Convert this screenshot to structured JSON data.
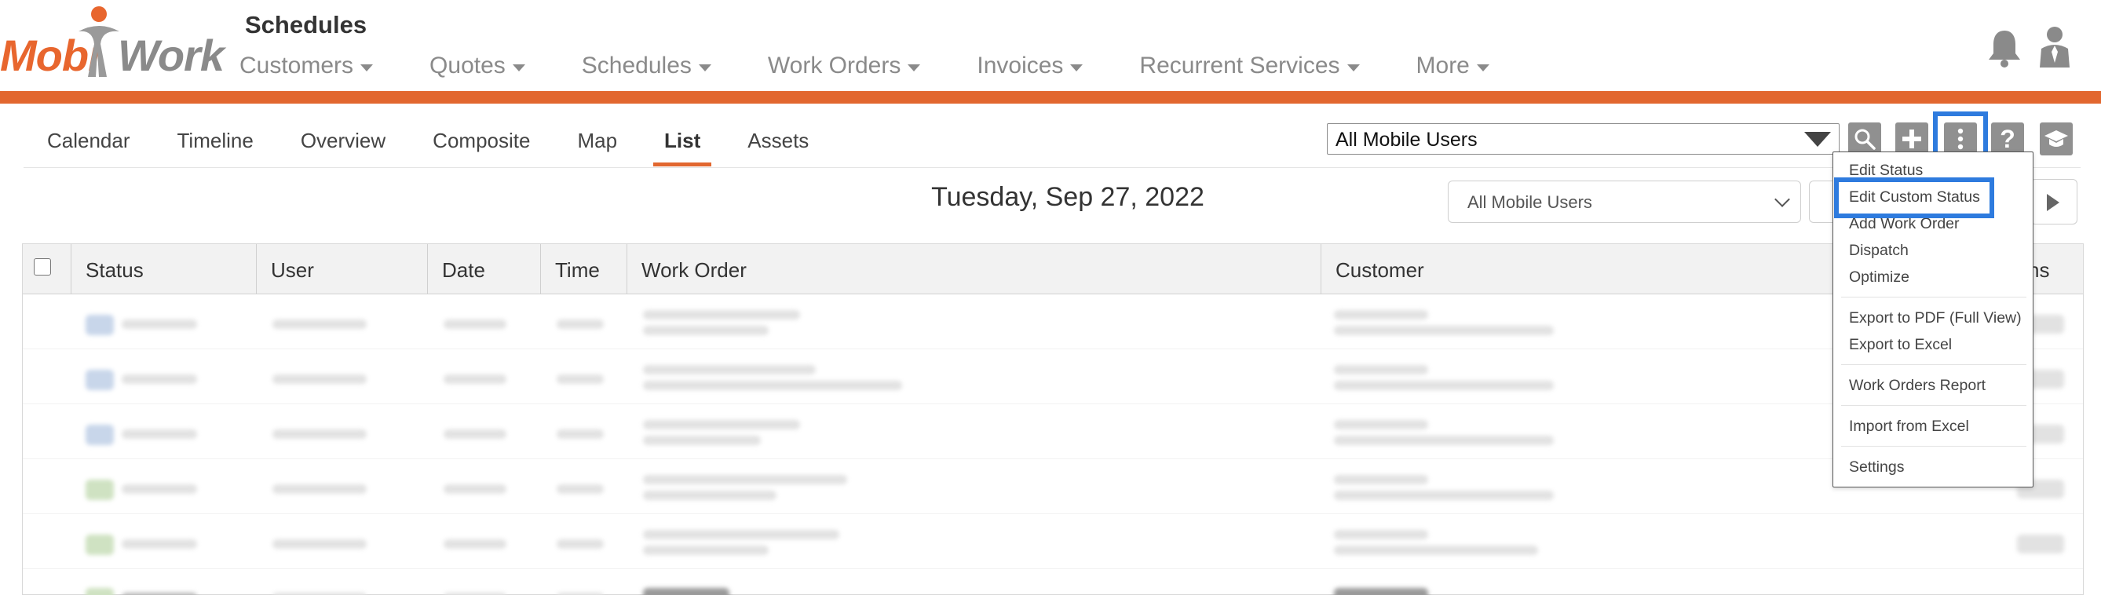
{
  "header": {
    "logo": "MobiWork",
    "page_title": "Schedules",
    "nav": [
      {
        "label": "Customers"
      },
      {
        "label": "Quotes"
      },
      {
        "label": "Schedules"
      },
      {
        "label": "Work Orders"
      },
      {
        "label": "Invoices"
      },
      {
        "label": "Recurrent Services"
      },
      {
        "label": "More"
      }
    ],
    "icons": [
      "bell-icon",
      "user-icon"
    ]
  },
  "colors": {
    "accent": "#e2672f",
    "highlight": "#2e7bde",
    "toolbar_button": "#909090"
  },
  "subtabs": [
    {
      "label": "Calendar"
    },
    {
      "label": "Timeline"
    },
    {
      "label": "Overview"
    },
    {
      "label": "Composite"
    },
    {
      "label": "Map"
    },
    {
      "label": "List",
      "active": true
    },
    {
      "label": "Assets"
    }
  ],
  "toolbar": {
    "user_select_value": "All Mobile Users",
    "buttons": [
      "search-icon",
      "plus-icon",
      "more-vertical-icon",
      "help-icon",
      "graduation-cap-icon"
    ]
  },
  "date_heading": "Tuesday, Sep 27, 2022",
  "filter_select_value": "All Mobile Users",
  "table": {
    "columns": [
      "Status",
      "User",
      "Date",
      "Time",
      "Work Order",
      "Customer",
      "ns"
    ]
  },
  "menu": {
    "items": [
      {
        "label": "Edit Status"
      },
      {
        "label": "Edit Custom Status",
        "highlighted": true
      },
      {
        "label": "Add Work Order"
      },
      {
        "label": "Dispatch"
      },
      {
        "label": "Optimize"
      },
      {
        "label": "Export to PDF (Full View)"
      },
      {
        "label": "Export to Excel"
      },
      {
        "label": "Work Orders Report"
      },
      {
        "label": "Import from Excel"
      },
      {
        "label": "Settings"
      }
    ]
  }
}
